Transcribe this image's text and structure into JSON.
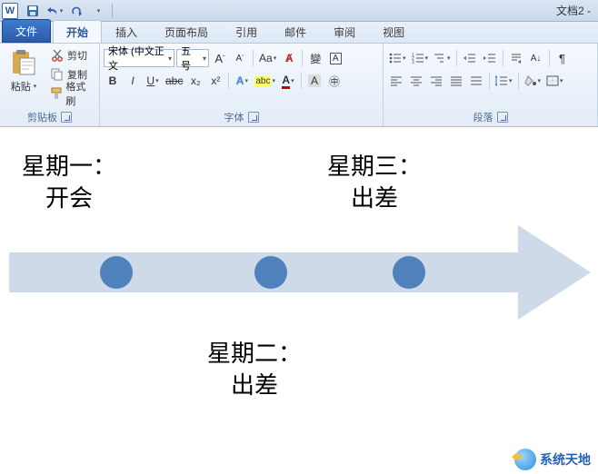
{
  "titlebar": {
    "doc_title": "文档2 -"
  },
  "tabs": {
    "file": "文件",
    "home": "开始",
    "insert": "插入",
    "layout": "页面布局",
    "references": "引用",
    "mailings": "邮件",
    "review": "审阅",
    "view": "视图"
  },
  "clipboard": {
    "paste": "粘贴",
    "cut": "剪切",
    "copy": "复制",
    "format_painter": "格式刷",
    "group": "剪贴板"
  },
  "font": {
    "name": "宋体 (中文正文",
    "size": "五号",
    "group": "字体",
    "bold": "B",
    "italic": "I",
    "underline": "U",
    "strike": "abc",
    "sub": "x₂",
    "sup": "x²",
    "grow": "A",
    "shrink": "A",
    "case": "Aa",
    "clear_fmt": "A",
    "text_effect": "A",
    "highlight": "abc",
    "font_color": "A",
    "pinyin": "變",
    "char_border": "A",
    "circled": "㊥"
  },
  "paragraph": {
    "group": "段落"
  },
  "smartart": {
    "item1_title": "星期一：",
    "item1_body": "开会",
    "item2_title": "星期二：",
    "item2_body": "出差",
    "item3_title": "星期三：",
    "item3_body": "出差"
  },
  "watermark": {
    "text": "系统天地"
  },
  "colors": {
    "arrow": "#cfdae9",
    "dot": "#4f81bd"
  }
}
